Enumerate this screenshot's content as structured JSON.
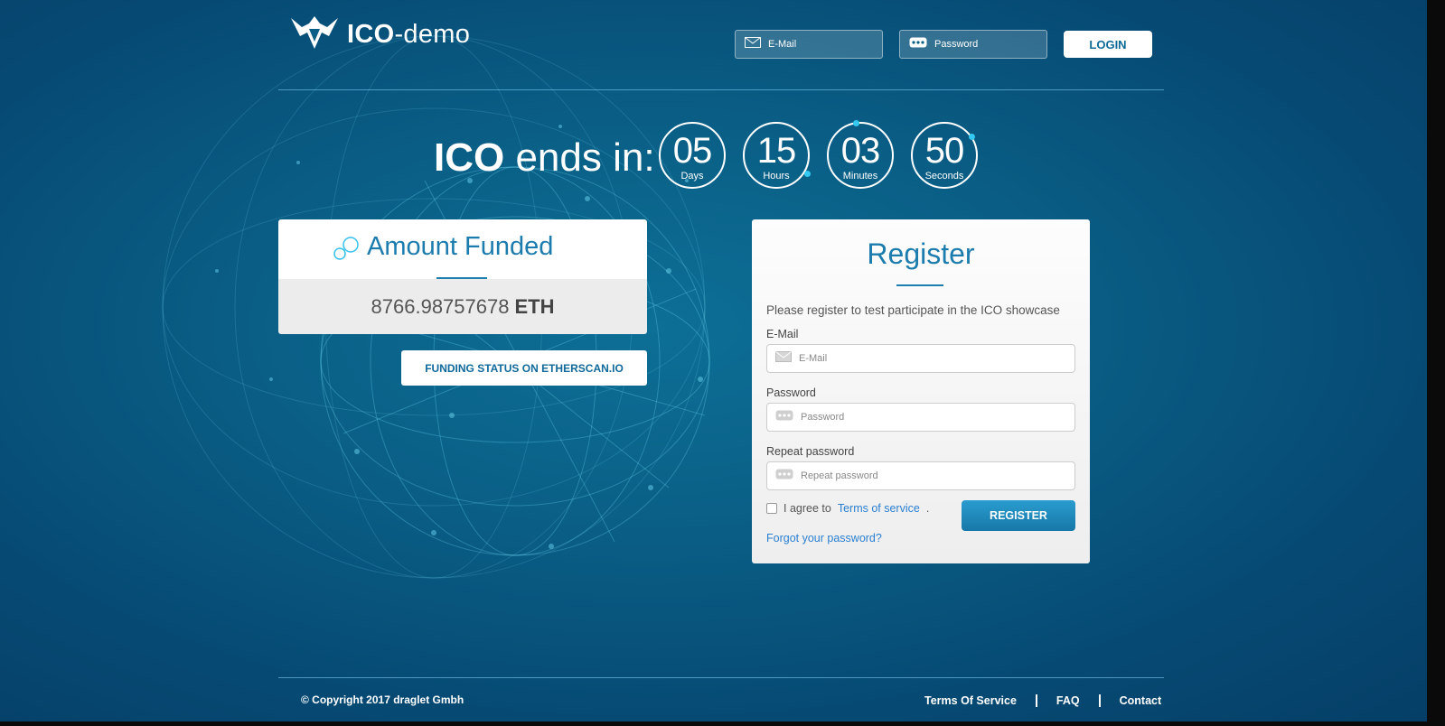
{
  "header": {
    "logo_bold": "ICO",
    "logo_rest": "-demo",
    "email_placeholder": "E-Mail",
    "password_placeholder": "Password",
    "login_label": "LOGIN"
  },
  "countdown": {
    "title_bold": "ICO",
    "title_rest": " ends in:",
    "units": [
      {
        "value": "05",
        "label": "Days"
      },
      {
        "value": "15",
        "label": "Hours"
      },
      {
        "value": "03",
        "label": "Minutes"
      },
      {
        "value": "50",
        "label": "Seconds"
      }
    ]
  },
  "funded": {
    "title": "Amount Funded",
    "amount": "8766.98757678",
    "unit": "ETH",
    "etherscan_label": "FUNDING STATUS ON ETHERSCAN.IO"
  },
  "register": {
    "title": "Register",
    "description": "Please register to test participate in the ICO showcase",
    "email_label": "E-Mail",
    "email_placeholder": "E-Mail",
    "password_label": "Password",
    "password_placeholder": "Password",
    "repeat_label": "Repeat password",
    "repeat_placeholder": "Repeat password",
    "agree_prefix": "I agree to",
    "terms_link": "Terms of service",
    "agree_suffix": ".",
    "register_label": "REGISTER",
    "forgot_label": "Forgot your password?"
  },
  "footer": {
    "copyright": "© Copyright 2017 draglet Gmbh",
    "links": [
      "Terms Of Service",
      "FAQ",
      "Contact"
    ]
  },
  "colors": {
    "accent": "#1d7cae",
    "link": "#2b7fd0",
    "background": "#0a5f86"
  }
}
